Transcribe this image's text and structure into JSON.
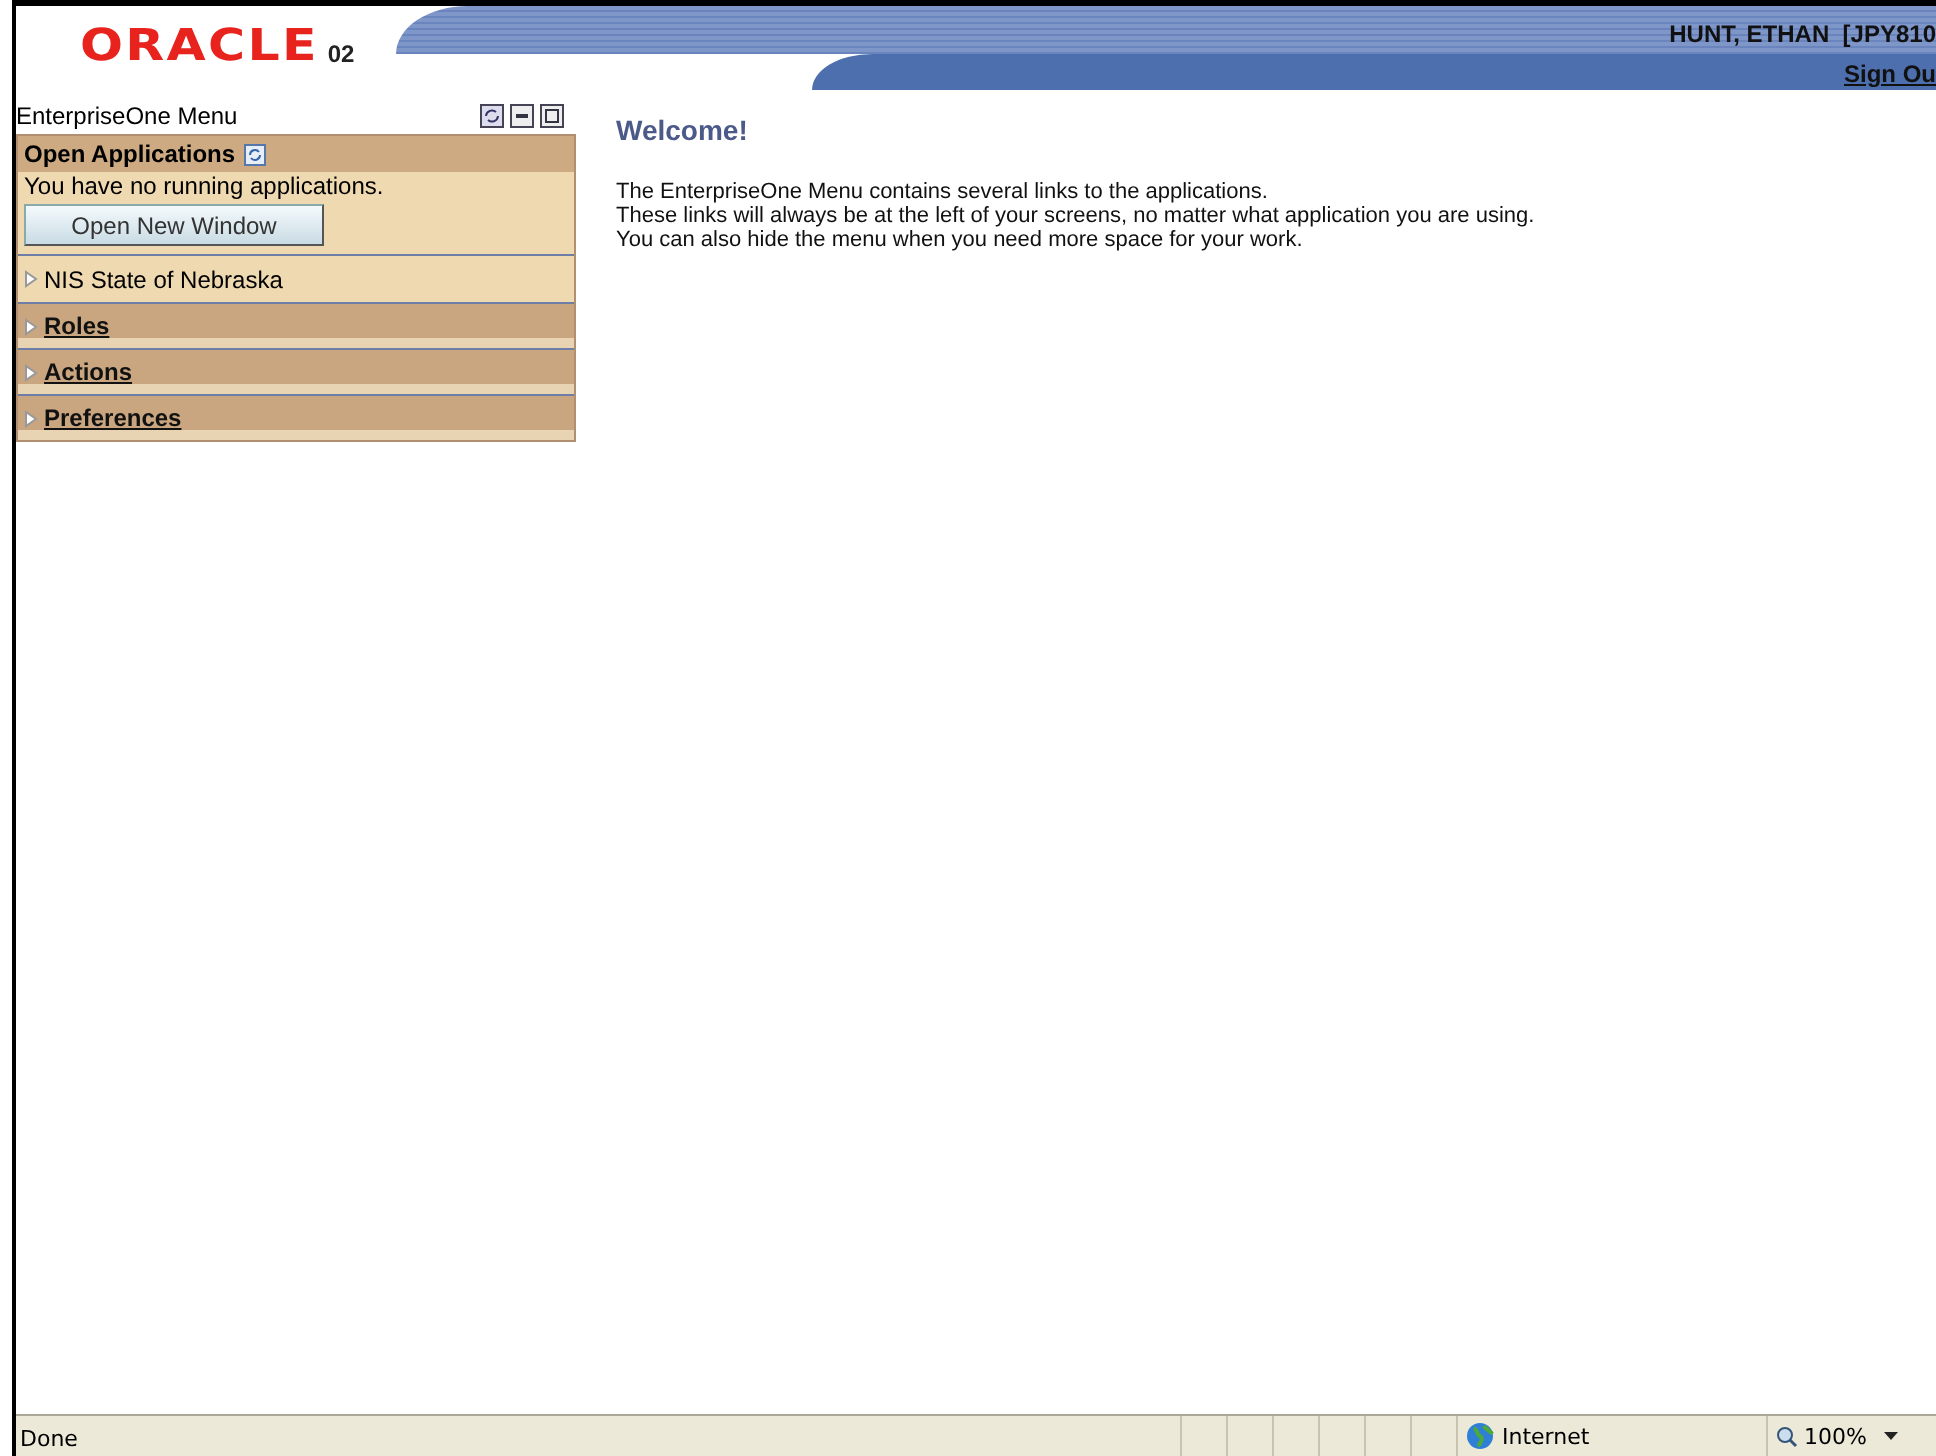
{
  "header": {
    "logo": "ORACLE",
    "logo_suffix": "02",
    "user": "HUNT, ETHAN  [JPY810",
    "sign_out": "Sign Ou"
  },
  "menu": {
    "title": "EnterpriseOne Menu",
    "open_applications": {
      "title": "Open Applications",
      "message": "You have no running applications.",
      "button": "Open New Window"
    },
    "items": [
      {
        "label": "NIS State of Nebraska",
        "kind": "folder",
        "expanded": false
      },
      {
        "label": "Roles",
        "kind": "section",
        "expanded": false
      },
      {
        "label": "Actions",
        "kind": "section",
        "expanded": false
      },
      {
        "label": "Preferences",
        "kind": "section",
        "expanded": false
      }
    ]
  },
  "welcome": {
    "title": "Welcome!",
    "lines": [
      "The EnterpriseOne Menu contains several links to the applications.",
      "These links will always be at the left of your screens, no matter what application you are using.",
      "You can also hide the menu when you need more space for your work."
    ]
  },
  "status_bar": {
    "text": "Done",
    "zone": "Internet",
    "zoom": "100%"
  }
}
